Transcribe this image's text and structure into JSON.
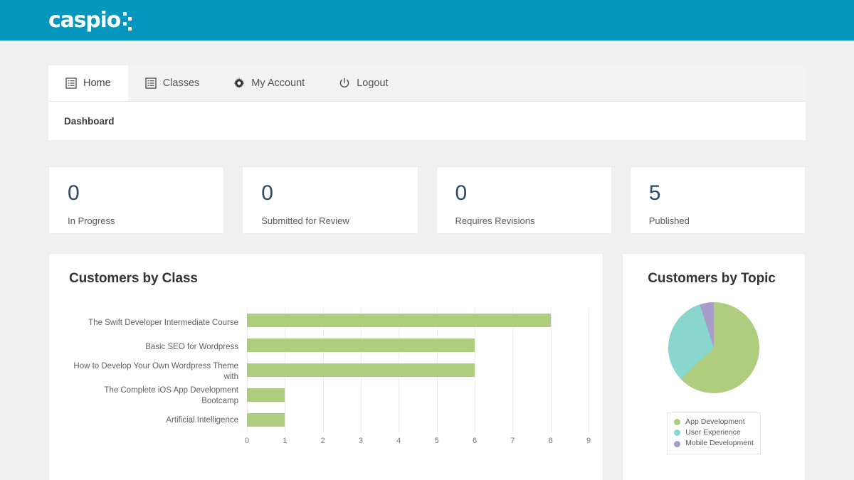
{
  "header": {
    "logo_text": "caspio",
    "logo_icon": "caspio-dots-logo",
    "bg_color": "#0496bd"
  },
  "tabs": [
    {
      "label": "Home",
      "icon": "list-icon",
      "active": true
    },
    {
      "label": "Classes",
      "icon": "list-icon",
      "active": false
    },
    {
      "label": "My Account",
      "icon": "gear-icon",
      "active": false
    },
    {
      "label": "Logout",
      "icon": "power-icon",
      "active": false
    }
  ],
  "breadcrumb": {
    "label": "Dashboard"
  },
  "stats": [
    {
      "value": "0",
      "label": "In Progress"
    },
    {
      "value": "0",
      "label": "Submitted for Review"
    },
    {
      "value": "0",
      "label": "Requires Revisions"
    },
    {
      "value": "5",
      "label": "Published"
    }
  ],
  "stat_value_color": "#2d4a63",
  "chart_data": [
    {
      "type": "bar",
      "orientation": "horizontal",
      "title": "Customers by Class",
      "categories": [
        "The Swift Developer Intermediate Course",
        "Basic SEO for Wordpress",
        "How to Develop Your Own Wordpress Theme with",
        "The Complete iOS App Development Bootcamp",
        "Artificial Intelligence"
      ],
      "values": [
        8,
        6,
        6,
        1,
        1
      ],
      "xlabel": "",
      "ylabel": "",
      "xlim": [
        0,
        9
      ],
      "xticks": [
        "0",
        "1",
        "2",
        "3",
        "4",
        "5",
        "6",
        "7",
        "8",
        "9"
      ],
      "grid": true,
      "bar_color": "#aecd7f",
      "legend": false
    },
    {
      "type": "pie",
      "title": "Customers by Topic",
      "labels": [
        "App Development",
        "User Experience",
        "Mobile Development"
      ],
      "values": [
        63,
        32,
        5
      ],
      "colors": [
        "#aecd7f",
        "#88d6cd",
        "#a89ccb"
      ],
      "legend_position": "bottom"
    }
  ]
}
